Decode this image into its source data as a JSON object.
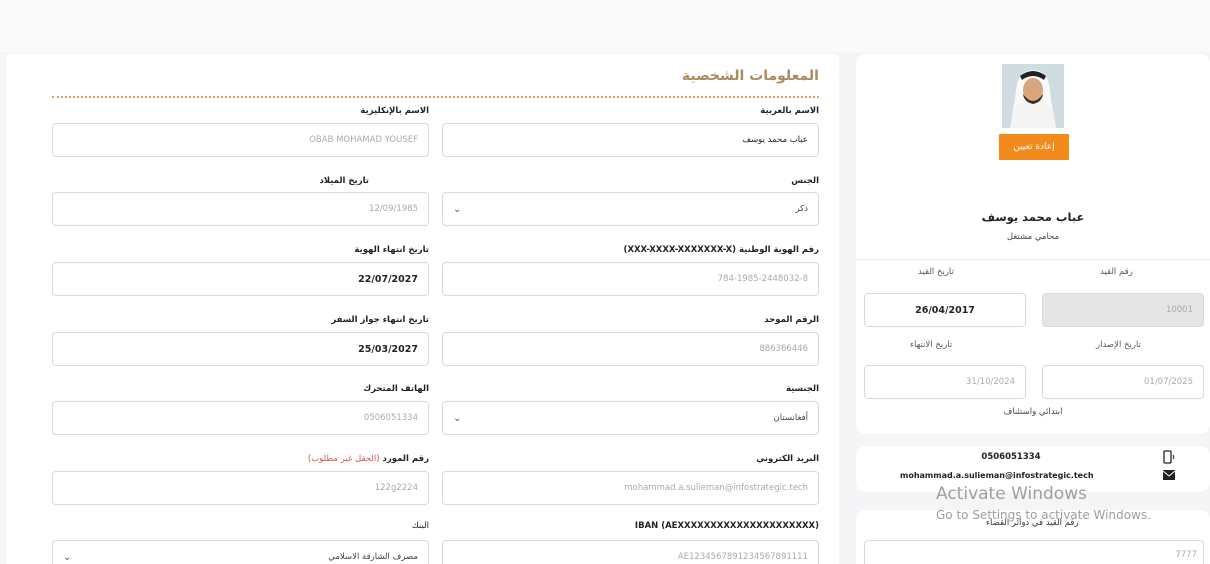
{
  "form": {
    "section_title": "المعلومات الشخصية",
    "fields": {
      "name_ar": {
        "label": "الاسم بالعربية",
        "value": "عباب محمد يوسف"
      },
      "name_en": {
        "label": "الاسم بالإنكليزية",
        "value": "OBAB MOHAMAD YOUSEF"
      },
      "gender": {
        "label": "الجنس",
        "value": "ذكر"
      },
      "birth_date": {
        "label": "تاريخ الميلاد",
        "value": "12/09/1985"
      },
      "national_id": {
        "label": "رقم الهوية الوطنية (XXX-XXXX-XXXXXXX-X)",
        "value": "784-1985-2448032-8"
      },
      "id_expiry": {
        "label": "تاريخ انتهاء الهوية",
        "value": "22/07/2027"
      },
      "unified_no": {
        "label": "الرقم الموحد",
        "value": "886366446"
      },
      "passport_expiry": {
        "label": "تاريخ انتهاء جواز السفر",
        "value": "25/03/2027"
      },
      "nationality": {
        "label": "الجنسية",
        "value": "أفغانستان"
      },
      "mobile": {
        "label": "الهاتف المتحرك",
        "value": "0506051334"
      },
      "email": {
        "label": "البريد الكتروني",
        "value": "mohammad.a.sulieman@infostrategic.tech"
      },
      "supplier_no": {
        "label": "رقم المورد",
        "note": "(الحقل غير مطلوب)",
        "value": "122g2224"
      },
      "iban": {
        "label": "IBAN (AEXXXXXXXXXXXXXXXXXXXXX)",
        "value": "AE1234567891234567891111"
      },
      "bank": {
        "label": "البنك",
        "value": "مصرف الشارقة الاسلامي"
      }
    }
  },
  "profile": {
    "reset_label": "إعادة تعيين",
    "name": "عباب محمد يوسف",
    "role": "محامي مشتغل",
    "reg_no": {
      "label": "رقم القيد",
      "value": "10001"
    },
    "reg_date": {
      "label": "تاريخ القيد",
      "value": "26/04/2017"
    },
    "issue_date": {
      "label": "تاريخ الإصدار",
      "value": "01/07/2025"
    },
    "expiry_date": {
      "label": "تاريخ الانتهاء",
      "value": "31/10/2024"
    },
    "license_type": "ابتدائي واستئناف"
  },
  "contact": {
    "phone": "0506051334",
    "email": "mohammad.a.sulieman@infostrategic.tech",
    "phone_icon": "mobile-phone-icon",
    "email_icon": "envelope-icon"
  },
  "court": {
    "label": "رقم القيد في دوائر القضاء",
    "value": "7777"
  },
  "watermark": {
    "line1": "Activate Windows",
    "line2": "Go to Settings to activate Windows."
  },
  "colors": {
    "accent": "#f28b1b",
    "title": "#a98b60",
    "required_note": "#d9534f"
  }
}
